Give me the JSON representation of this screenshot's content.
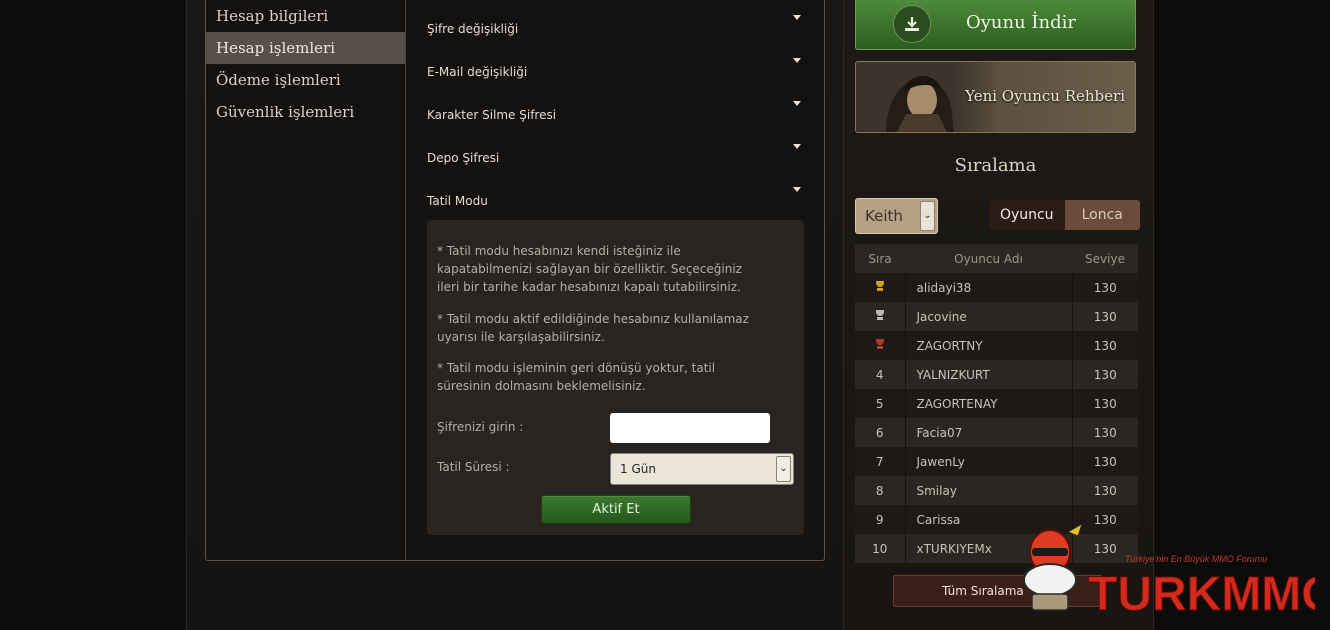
{
  "menu": {
    "items": [
      {
        "label": "Hesap bilgileri",
        "active": false
      },
      {
        "label": "Hesap işlemleri",
        "active": true
      },
      {
        "label": "Ödeme işlemleri",
        "active": false
      },
      {
        "label": "Güvenlik işlemleri",
        "active": false
      }
    ]
  },
  "accordion": {
    "items": [
      {
        "label": "Şifre değişikliği"
      },
      {
        "label": "E-Mail değişikliği"
      },
      {
        "label": "Karakter Silme Şifresi"
      },
      {
        "label": "Depo Şifresi"
      },
      {
        "label": "Tatil Modu"
      }
    ]
  },
  "vacation": {
    "notes": [
      "* Tatil modu hesabınızı kendi isteğiniz ile kapatabilmenizi sağlayan bir özelliktir. Seçeceğiniz ileri bir tarihe kadar hesabınızı kapalı tutabilirsiniz.",
      "* Tatil modu aktif edildiğinde hesabınız kullanılamaz uyarısı ile karşılaşabilirsiniz.",
      "* Tatil modu işleminin geri dönüşü yoktur, tatil süresinin dolmasını beklemelisiniz."
    ],
    "password_label": "Şifrenizi girin :",
    "password_value": "",
    "duration_label": "Tatil Süresi :",
    "duration_selected": "1 Gün",
    "submit_label": "Aktif Et"
  },
  "sidebar": {
    "download_label": "Oyunu İndir",
    "guide_label": "Yeni Oyuncu Rehberi",
    "ranking_title": "Sıralama",
    "server_selected": "Keith",
    "tabs": [
      {
        "label": "Oyuncu",
        "active": true
      },
      {
        "label": "Lonca",
        "active": false
      }
    ],
    "table": {
      "headers": [
        "Sıra",
        "Oyuncu Adı",
        "Seviye"
      ],
      "rows": [
        {
          "rank": "",
          "trophy": "gold",
          "name": "alidayi38",
          "level": "130"
        },
        {
          "rank": "",
          "trophy": "silver",
          "name": "Jacovine",
          "level": "130"
        },
        {
          "rank": "",
          "trophy": "bronze",
          "name": "ZAGORTNY",
          "level": "130"
        },
        {
          "rank": "4",
          "trophy": "",
          "name": "YALNIZKURT",
          "level": "130"
        },
        {
          "rank": "5",
          "trophy": "",
          "name": "ZAGORTENAY",
          "level": "130"
        },
        {
          "rank": "6",
          "trophy": "",
          "name": "Facia07",
          "level": "130"
        },
        {
          "rank": "7",
          "trophy": "",
          "name": "JawenLy",
          "level": "130"
        },
        {
          "rank": "8",
          "trophy": "",
          "name": "Smilay",
          "level": "130"
        },
        {
          "rank": "9",
          "trophy": "",
          "name": "Carissa",
          "level": "130"
        },
        {
          "rank": "10",
          "trophy": "",
          "name": "xTURKIYEMx",
          "level": "130"
        }
      ]
    },
    "all_rankings_label": "Tüm Sıralama"
  },
  "watermark": {
    "tagline": "Türkiye'nin En Büyük MMO Forumu",
    "brand": "TURKMMO"
  },
  "colors": {
    "trophy_gold": "#d4a017",
    "trophy_silver": "#b9b9b9",
    "trophy_bronze": "#b23a2a",
    "accent_green": "#2d6a23"
  }
}
